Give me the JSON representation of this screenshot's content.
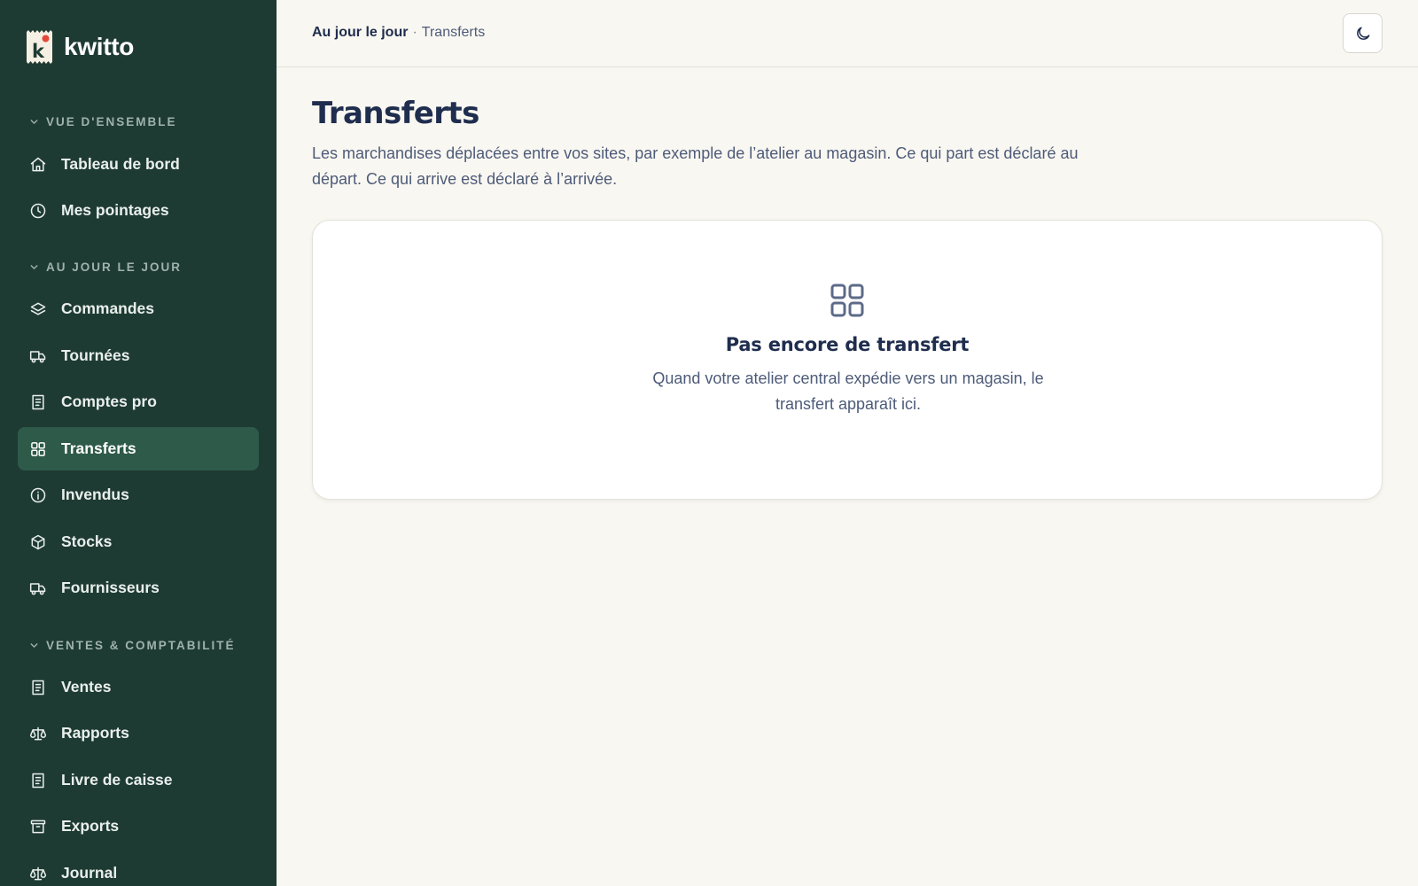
{
  "app": {
    "name": "kwitto"
  },
  "colors": {
    "sidebar_bg": "#1e3b33",
    "sidebar_active": "#2e5a4a",
    "page_bg": "#f9f7f1",
    "text_primary": "#1f2d4e",
    "text_secondary": "#4d5b79",
    "logo_accent": "#e5483b"
  },
  "sidebar": {
    "sections": [
      {
        "title": "Vue d'ensemble",
        "items": [
          {
            "label": "Tableau de bord",
            "icon": "home-icon"
          },
          {
            "label": "Mes pointages",
            "icon": "clock-icon"
          }
        ]
      },
      {
        "title": "Au jour le jour",
        "items": [
          {
            "label": "Commandes",
            "icon": "layers-icon"
          },
          {
            "label": "Tournées",
            "icon": "truck-icon"
          },
          {
            "label": "Comptes pro",
            "icon": "receipt-icon"
          },
          {
            "label": "Transferts",
            "icon": "grid-icon",
            "active": true
          },
          {
            "label": "Invendus",
            "icon": "info-icon"
          },
          {
            "label": "Stocks",
            "icon": "box-icon"
          },
          {
            "label": "Fournisseurs",
            "icon": "truck-icon"
          }
        ]
      },
      {
        "title": "Ventes & comptabilité",
        "items": [
          {
            "label": "Ventes",
            "icon": "receipt-icon"
          },
          {
            "label": "Rapports",
            "icon": "scale-icon"
          },
          {
            "label": "Livre de caisse",
            "icon": "receipt-icon"
          },
          {
            "label": "Exports",
            "icon": "archive-icon"
          },
          {
            "label": "Journal",
            "icon": "scale-icon"
          }
        ]
      }
    ]
  },
  "header": {
    "breadcrumb_parent": "Au jour le jour",
    "breadcrumb_separator": "·",
    "breadcrumb_current": "Transferts",
    "theme_toggle_icon": "moon-icon"
  },
  "main": {
    "title": "Transferts",
    "description": "Les marchandises déplacées entre vos sites, par exemple de l’atelier au magasin. Ce qui part est déclaré au départ. Ce qui arrive est déclaré à l’arrivée.",
    "empty_state": {
      "icon": "grid-icon",
      "title": "Pas encore de transfert",
      "text": "Quand votre atelier central expédie vers un magasin, le transfert apparaît ici."
    }
  }
}
